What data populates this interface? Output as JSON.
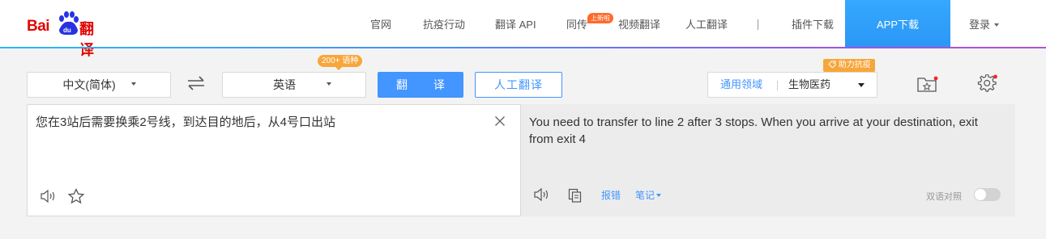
{
  "logo": {
    "part1": "Bai",
    "part2": "du",
    "part3": "翻译"
  },
  "nav": {
    "items": [
      "官网",
      "抗疫行动",
      "翻译 API",
      "同传",
      "视频翻译",
      "人工翻译",
      "插件下载"
    ],
    "badge": "上新啦",
    "app_download": "APP下载",
    "login": "登录"
  },
  "toolbar": {
    "source_lang": "中文(简体)",
    "target_lang": "英语",
    "lang_count_badge": "200+ 语种",
    "translate_button": "翻 译",
    "human_translate_button": "人工翻译",
    "domain_label": "通用领域",
    "domain_value": "生物医药",
    "help_badge": "助力抗疫"
  },
  "source": {
    "text": "您在3站后需要换乘2号线，到达目的地后，从4号口出站"
  },
  "target": {
    "text": "You need to transfer to line 2 after 3 stops. When you arrive at your destination, exit from exit 4",
    "report_link": "报错",
    "notes_link": "笔记",
    "bilingual_label": "双语对照",
    "bilingual_enabled": false
  },
  "colors": {
    "accent": "#4395ff",
    "brand_red": "#e10602",
    "badge_orange": "#f7a63b",
    "app_button": "#2b97f5"
  },
  "icons": [
    "swap-icon",
    "favorites-icon",
    "settings-icon",
    "clear-icon",
    "speaker-icon",
    "star-icon",
    "copy-icon",
    "tag-icon"
  ]
}
